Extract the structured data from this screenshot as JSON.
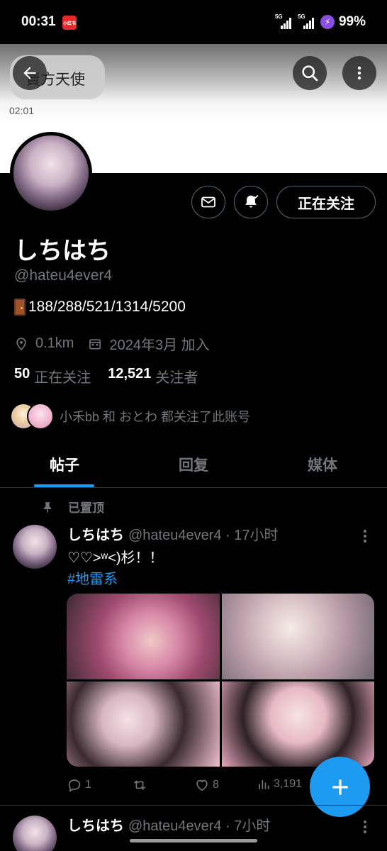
{
  "status_bar": {
    "time": "00:31",
    "app_badge": "小红书",
    "net1": "5G",
    "net2": "5G",
    "battery": "99%"
  },
  "header": {
    "banner_label": "賣方天使",
    "banner_time": "02:01"
  },
  "profile": {
    "display_name": "しちはち",
    "handle": "@hateu4ever4",
    "bio": "188/288/521/1314/5200",
    "location": "0.1km",
    "joined": "2024年3月 加入",
    "following_count": "50",
    "following_label": "正在关注",
    "followers_count": "12,521",
    "followers_label": "关注者",
    "mutual_text": "小禾bb 和 おとわ 都关注了此账号",
    "follow_button_label": "正在关注"
  },
  "tabs": [
    {
      "label": "帖子",
      "active": true
    },
    {
      "label": "回复",
      "active": false
    },
    {
      "label": "媒体",
      "active": false
    }
  ],
  "pinned": {
    "label": "已置顶"
  },
  "post": {
    "name": "しちはち",
    "handle_time": "@hateu4ever4 · 17小时",
    "text": "♡♡>ʷ<)杉！！",
    "hashtag": "#地雷系",
    "replies": "1",
    "retweets": "",
    "likes": "8",
    "views": "3,191"
  },
  "post2": {
    "name": "しちはち",
    "handle_time": "@hateu4ever4 · 7小时"
  },
  "colors": {
    "accent": "#1d9bf0",
    "muted": "#71767b",
    "background": "#000000"
  }
}
